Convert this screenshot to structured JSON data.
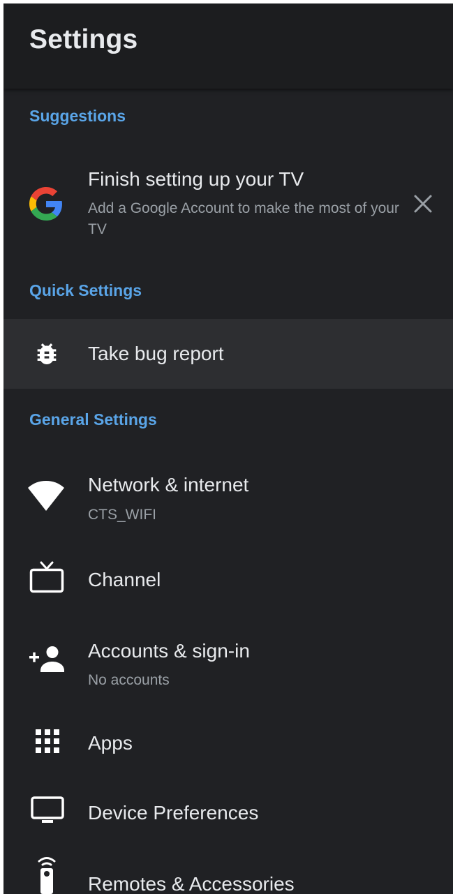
{
  "header": {
    "title": "Settings"
  },
  "sections": {
    "suggestions": "Suggestions",
    "quick_settings": "Quick Settings",
    "general_settings": "General Settings"
  },
  "suggestion": {
    "title": "Finish setting up your TV",
    "subtitle": "Add a Google Account to make the most of your TV",
    "icon": "google-icon",
    "dismiss_icon": "close-icon"
  },
  "quick": [
    {
      "label": "Take bug report",
      "icon": "bug-icon"
    }
  ],
  "general": [
    {
      "label": "Network & internet",
      "sublabel": "CTS_WIFI",
      "icon": "wifi-icon"
    },
    {
      "label": "Channel",
      "icon": "tv-icon"
    },
    {
      "label": "Accounts & sign-in",
      "sublabel": "No accounts",
      "icon": "add-person-icon"
    },
    {
      "label": "Apps",
      "icon": "apps-grid-icon"
    },
    {
      "label": "Device Preferences",
      "icon": "monitor-icon"
    },
    {
      "label": "Remotes & Accessories",
      "icon": "remote-icon"
    }
  ],
  "colors": {
    "background": "#202124",
    "header": "#1c1d1f",
    "accent": "#5aa5e8",
    "focused_row": "#2d2e31",
    "text_primary": "#e8eaed",
    "text_secondary": "#9aa0a6"
  }
}
